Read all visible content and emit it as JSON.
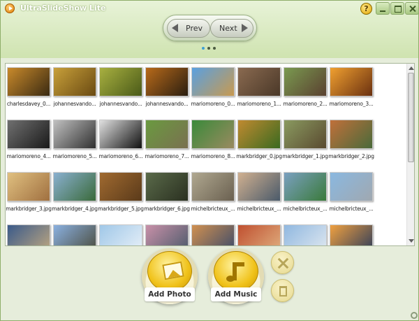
{
  "window": {
    "title": "UltraSlideShow Lite",
    "help_label": "?"
  },
  "nav": {
    "prev_label": "Prev",
    "next_label": "Next"
  },
  "thumbnails": [
    {
      "label": "charlesdavey_0...",
      "colors": [
        "#c98a2b",
        "#3a2a12"
      ]
    },
    {
      "label": "johannesvando...",
      "colors": [
        "#c8a03a",
        "#6a4a12"
      ]
    },
    {
      "label": "johannesvando...",
      "colors": [
        "#a8b040",
        "#4a5a18"
      ]
    },
    {
      "label": "johannesvando...",
      "colors": [
        "#b86a1a",
        "#2a1e10"
      ]
    },
    {
      "label": "mariomoreno_0...",
      "colors": [
        "#5aa0e0",
        "#c89a50"
      ]
    },
    {
      "label": "mariomoreno_1...",
      "colors": [
        "#8a6a50",
        "#4a3828"
      ]
    },
    {
      "label": "mariomoreno_2...",
      "colors": [
        "#7a9a50",
        "#5a4030"
      ]
    },
    {
      "label": "mariomoreno_3...",
      "colors": [
        "#f0a030",
        "#6a3010"
      ]
    },
    {
      "label": "mariomoreno_4...",
      "colors": [
        "#707070",
        "#1a1a1a"
      ]
    },
    {
      "label": "mariomoreno_5...",
      "colors": [
        "#c0c0c0",
        "#303030"
      ]
    },
    {
      "label": "mariomoreno_6...",
      "colors": [
        "#e0e0e0",
        "#101010"
      ]
    },
    {
      "label": "mariomoreno_7...",
      "colors": [
        "#6a9a40",
        "#7a7050"
      ]
    },
    {
      "label": "mariomoreno_8...",
      "colors": [
        "#3a8a3a",
        "#9a8a60"
      ]
    },
    {
      "label": "markbridger_0.jpg",
      "colors": [
        "#c08a30",
        "#3a6a20"
      ]
    },
    {
      "label": "markbridger_1.jpg",
      "colors": [
        "#8a9a60",
        "#5a4a30"
      ]
    },
    {
      "label": "markbridger_2.jpg",
      "colors": [
        "#c0703a",
        "#4a6a3a"
      ]
    },
    {
      "label": "markbridger_3.jpg",
      "colors": [
        "#e0c080",
        "#a07040"
      ]
    },
    {
      "label": "markbridger_4.jpg",
      "colors": [
        "#8ab0d0",
        "#3a6a3a"
      ]
    },
    {
      "label": "markbridger_5.jpg",
      "colors": [
        "#a06a30",
        "#5a3a1a"
      ]
    },
    {
      "label": "markbridger_6.jpg",
      "colors": [
        "#5a6a4a",
        "#2a3020"
      ]
    },
    {
      "label": "michelbricteux_...",
      "colors": [
        "#b0a890",
        "#6a6050"
      ]
    },
    {
      "label": "michelbricteux_...",
      "colors": [
        "#d0b090",
        "#4a5a6a"
      ]
    },
    {
      "label": "michelbricteux_...",
      "colors": [
        "#7aa0c0",
        "#3a7a3a"
      ]
    },
    {
      "label": "michelbricteux_...",
      "colors": [
        "#8ab8e0",
        "#a0a8b0"
      ]
    },
    {
      "label": "",
      "colors": [
        "#3a5a8a",
        "#c0a880"
      ]
    },
    {
      "label": "",
      "colors": [
        "#8ab0e0",
        "#4a4a3a"
      ]
    },
    {
      "label": "",
      "colors": [
        "#a0c8e8",
        "#e8f0f8"
      ]
    },
    {
      "label": "",
      "colors": [
        "#c890a8",
        "#4a5a6a"
      ]
    },
    {
      "label": "",
      "colors": [
        "#d09050",
        "#3a4a6a"
      ]
    },
    {
      "label": "",
      "colors": [
        "#c05030",
        "#e0b080"
      ]
    },
    {
      "label": "",
      "colors": [
        "#90b8e0",
        "#e0e8f0"
      ]
    },
    {
      "label": "",
      "colors": [
        "#f0a040",
        "#2a3a5a"
      ]
    }
  ],
  "actions": {
    "add_photo_label": "Add Photo",
    "add_music_label": "Add Music"
  }
}
